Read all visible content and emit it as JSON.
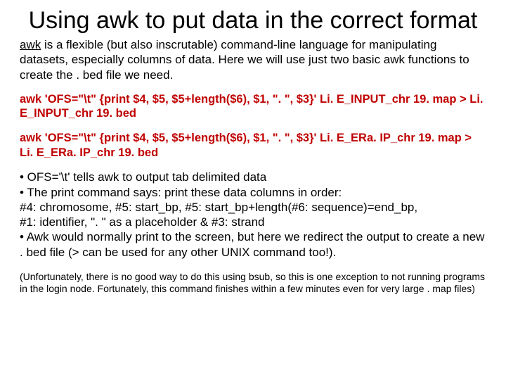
{
  "title": "Using awk to put data in the correct format",
  "intro_html": "<u>awk</u> is a flexible (but also inscrutable) command-line language for manipulating datasets, especially columns of data. Here we will use just two basic awk functions to create the . bed file we need.",
  "cmd1": "awk 'OFS=\"\\t\" {print $4, $5, $5+length($6), $1, \". \", $3}' Li. E_INPUT_chr 19. map > Li. E_INPUT_chr 19. bed",
  "cmd2": "awk 'OFS=\"\\t\" {print $4, $5, $5+length($6), $1, \". \", $3}' Li. E_ERa. IP_chr 19. map > Li. E_ERa. IP_chr 19. bed",
  "b1": "• OFS='\\t' tells awk to output tab delimited data",
  "b2": "• The print command says: print these data columns in order:",
  "b3": "#4: chromosome, #5: start_bp, #5: start_bp+length(#6: sequence)=end_bp,",
  "b4": "#1: identifier, \". \" as a placeholder & #3: strand",
  "b5": "• Awk would normally print to the screen, but here we redirect the output to create a new . bed file (> can be used for any other UNIX command too!).",
  "foot": "(Unfortunately, there is no good way to do this using bsub, so this is one exception to not running programs in the login node. Fortunately, this command finishes within a few minutes even for very large . map files)"
}
